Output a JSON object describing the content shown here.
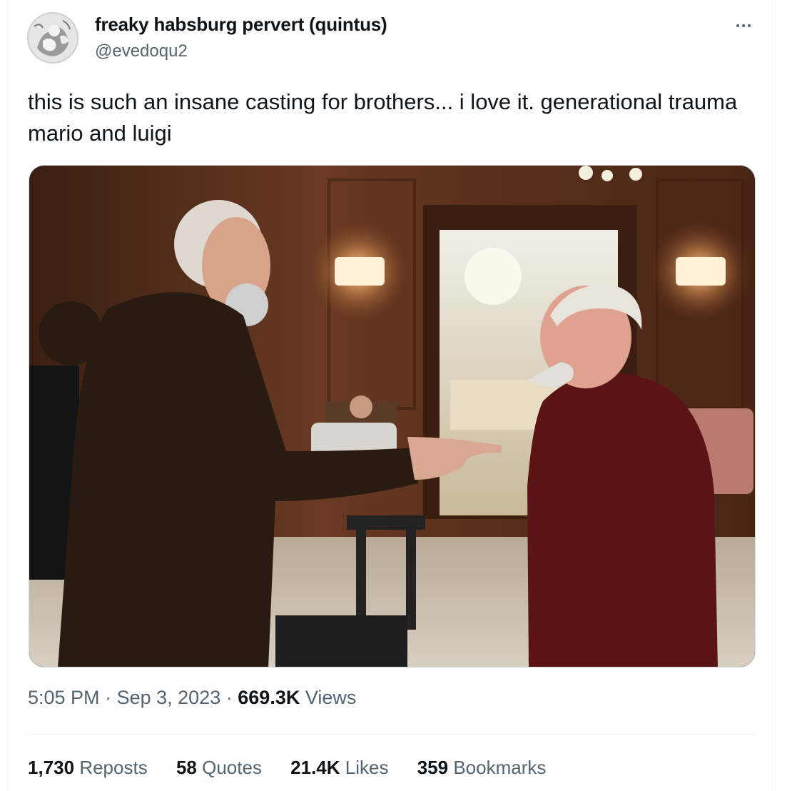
{
  "author": {
    "display_name": "freaky habsburg pervert (quintus)",
    "handle": "@evedoqu2"
  },
  "tweet": {
    "text": "this is such an insane casting for brothers... i love it. generational trauma mario and luigi"
  },
  "meta": {
    "time": "5:05 PM",
    "date": "Sep 3, 2023",
    "views_count": "669.3K",
    "views_label": "Views",
    "separator": "·"
  },
  "stats": {
    "reposts": {
      "count": "1,730",
      "label": "Reposts"
    },
    "quotes": {
      "count": "58",
      "label": "Quotes"
    },
    "likes": {
      "count": "21.4K",
      "label": "Likes"
    },
    "bookmarks": {
      "count": "359",
      "label": "Bookmarks"
    }
  },
  "icons": {
    "more": "more-horizontal-icon",
    "avatar": "cherub-engraving-avatar"
  },
  "colors": {
    "text_primary": "#0f1419",
    "text_secondary": "#536471",
    "border": "#eff3f4"
  }
}
